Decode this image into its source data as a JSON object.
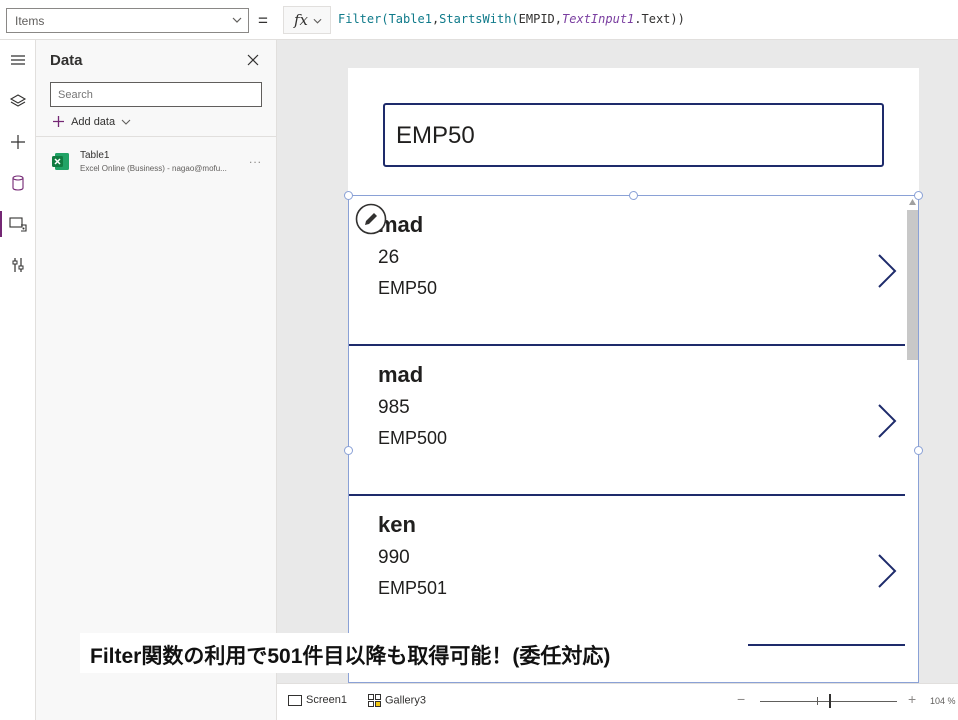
{
  "formula_bar": {
    "property": "Items",
    "equals": "=",
    "fx": "fx",
    "formula_fn": "Filter(",
    "formula_arg1": "Table1",
    "formula_comma": ",",
    "formula_fn2": "StartsWith(",
    "formula_field": "EMPID,",
    "formula_ctl": "TextInput1",
    "formula_tail": ".Text))"
  },
  "data_pane": {
    "title": "Data",
    "search_placeholder": "Search",
    "add_data_label": "Add data",
    "source": {
      "name": "Table1",
      "subtitle": "Excel Online (Business) - nagao@mofu...",
      "more": "..."
    }
  },
  "canvas": {
    "text_input_value": "EMP50",
    "gallery_rows": [
      {
        "name": "mad",
        "age": "26",
        "empid": "EMP50"
      },
      {
        "name": "mad",
        "age": "985",
        "empid": "EMP500"
      },
      {
        "name": "ken",
        "age": "990",
        "empid": "EMP501"
      }
    ]
  },
  "bottom_bar": {
    "screen_label": "Screen1",
    "gallery_label": "Gallery3",
    "zoom_minus": "−",
    "zoom_plus": "+",
    "zoom_level": "104 %",
    "zoom_value_percent": 104
  },
  "caption": "Filter関数の利用で501件目以降も取得可能！(委任対応)",
  "colors": {
    "accent": "#742774",
    "input_border": "#1e2b6b",
    "selection": "#8aa1d6",
    "excel_green": "#107c41"
  }
}
